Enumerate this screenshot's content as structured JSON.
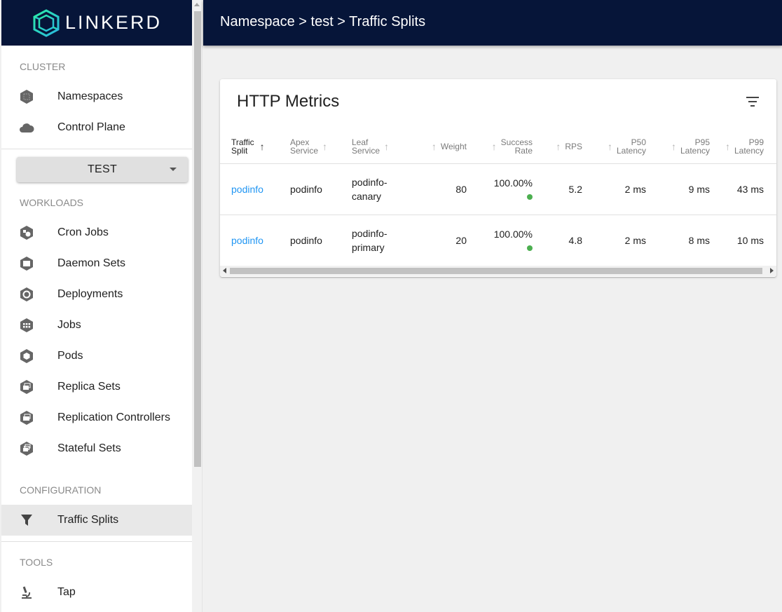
{
  "app": {
    "logo_text": "LINKERD"
  },
  "header": {
    "breadcrumb": "Namespace > test > Traffic Splits"
  },
  "sidebar": {
    "cluster_label": "CLUSTER",
    "cluster_items": [
      {
        "label": "Namespaces",
        "icon": "namespace-icon"
      },
      {
        "label": "Control Plane",
        "icon": "cloud-icon"
      }
    ],
    "namespace_select": "TEST",
    "workloads_label": "WORKLOADS",
    "workload_items": [
      {
        "label": "Cron Jobs",
        "icon": "cronjob-icon"
      },
      {
        "label": "Daemon Sets",
        "icon": "daemonset-icon"
      },
      {
        "label": "Deployments",
        "icon": "deployment-icon"
      },
      {
        "label": "Jobs",
        "icon": "job-icon"
      },
      {
        "label": "Pods",
        "icon": "pod-icon"
      },
      {
        "label": "Replica Sets",
        "icon": "replicaset-icon"
      },
      {
        "label": "Replication Controllers",
        "icon": "replicationcontroller-icon"
      },
      {
        "label": "Stateful Sets",
        "icon": "statefulset-icon"
      }
    ],
    "configuration_label": "CONFIGURATION",
    "configuration_items": [
      {
        "label": "Traffic Splits",
        "icon": "filter-funnel-icon",
        "active": true
      }
    ],
    "tools_label": "TOOLS",
    "tools_items": [
      {
        "label": "Tap",
        "icon": "microscope-icon"
      }
    ]
  },
  "card": {
    "title": "HTTP Metrics",
    "columns": [
      {
        "line1": "Traffic",
        "line2": "Split",
        "arrow": "↑"
      },
      {
        "line1": "Apex",
        "line2": "Service",
        "arrow": "↑"
      },
      {
        "line1": "Leaf",
        "line2": "Service",
        "arrow": "↑"
      },
      {
        "line1": "Weight",
        "line2": "",
        "arrow": "↑"
      },
      {
        "line1": "Success",
        "line2": "Rate",
        "arrow": "↑"
      },
      {
        "line1": "RPS",
        "line2": "",
        "arrow": "↑"
      },
      {
        "line1": "P50",
        "line2": "Latency",
        "arrow": "↑"
      },
      {
        "line1": "P95",
        "line2": "Latency",
        "arrow": "↑"
      },
      {
        "line1": "P99",
        "line2": "Latency",
        "arrow": "↑"
      }
    ],
    "rows": [
      {
        "traffic_split": "podinfo",
        "apex_service": "podinfo",
        "leaf_line1": "podinfo-",
        "leaf_line2": "canary",
        "weight": "80",
        "success_rate": "100.00%",
        "rps": "5.2",
        "p50": "2 ms",
        "p95": "9 ms",
        "p99": "43 ms"
      },
      {
        "traffic_split": "podinfo",
        "apex_service": "podinfo",
        "leaf_line1": "podinfo-",
        "leaf_line2": "primary",
        "weight": "20",
        "success_rate": "100.00%",
        "rps": "4.8",
        "p50": "2 ms",
        "p95": "8 ms",
        "p99": "10 ms"
      }
    ]
  },
  "colors": {
    "header_bg": "#061539",
    "link": "#2196f3",
    "success_dot": "#4caf50",
    "logo_accent": "#2beda7"
  }
}
